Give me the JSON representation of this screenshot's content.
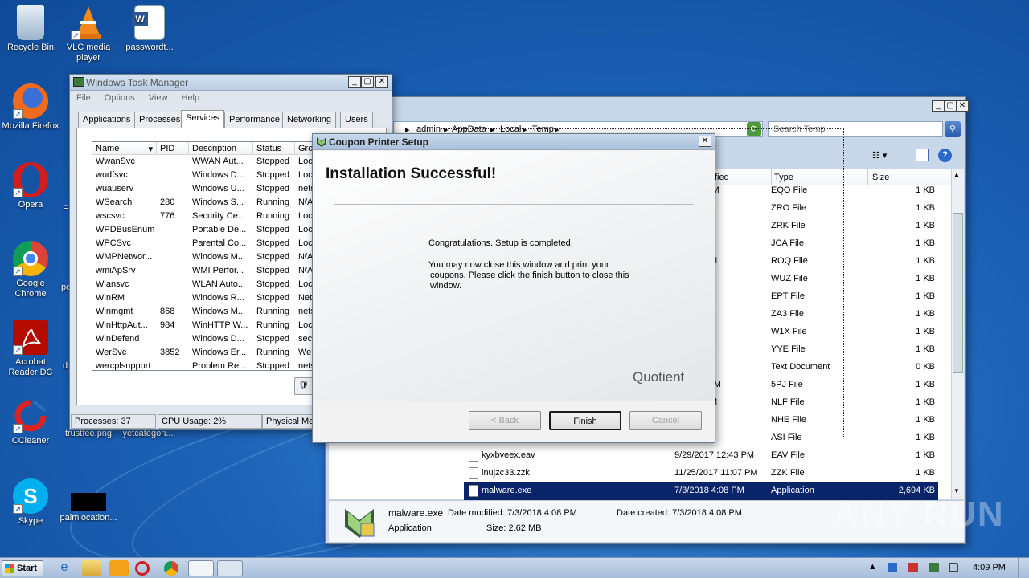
{
  "desktop": {
    "icons": [
      {
        "label": "Recycle Bin"
      },
      {
        "label": "VLC media player"
      },
      {
        "label": "passwordt..."
      },
      {
        "label": "Mozilla Firefox"
      },
      {
        "label": "Opera"
      },
      {
        "label": "Google Chrome"
      },
      {
        "label": "Acrobat Reader DC"
      },
      {
        "label": "CCleaner"
      },
      {
        "label": "Skype"
      },
      {
        "label": "trustfee.png"
      },
      {
        "label": "yetcategori..."
      },
      {
        "label": "palmlocation..."
      }
    ],
    "partial_labels": {
      "opera_side": "F",
      "chrome_side": "po",
      "acrobat_side": "d"
    }
  },
  "task_manager": {
    "title": "Windows Task Manager",
    "menu": [
      "File",
      "Options",
      "View",
      "Help"
    ],
    "tabs": [
      "Applications",
      "Processes",
      "Services",
      "Performance",
      "Networking",
      "Users"
    ],
    "active_tab": "Services",
    "columns": [
      "Name",
      "PID",
      "Description",
      "Status",
      "Gro"
    ],
    "rows": [
      {
        "name": "WwanSvc",
        "pid": "",
        "desc": "WWAN Aut...",
        "status": "Stopped",
        "group": "Loca"
      },
      {
        "name": "wudfsvc",
        "pid": "",
        "desc": "Windows D...",
        "status": "Stopped",
        "group": "Loca"
      },
      {
        "name": "wuauserv",
        "pid": "",
        "desc": "Windows U...",
        "status": "Stopped",
        "group": "nets"
      },
      {
        "name": "WSearch",
        "pid": "280",
        "desc": "Windows S...",
        "status": "Running",
        "group": "N/A"
      },
      {
        "name": "wscsvc",
        "pid": "776",
        "desc": "Security Ce...",
        "status": "Running",
        "group": "Loca"
      },
      {
        "name": "WPDBusEnum",
        "pid": "",
        "desc": "Portable De...",
        "status": "Stopped",
        "group": "Loca"
      },
      {
        "name": "WPCSvc",
        "pid": "",
        "desc": "Parental Co...",
        "status": "Stopped",
        "group": "Loca"
      },
      {
        "name": "WMPNetwor...",
        "pid": "",
        "desc": "Windows M...",
        "status": "Stopped",
        "group": "N/A"
      },
      {
        "name": "wmiApSrv",
        "pid": "",
        "desc": "WMI Perfor...",
        "status": "Stopped",
        "group": "N/A"
      },
      {
        "name": "Wlansvc",
        "pid": "",
        "desc": "WLAN Auto...",
        "status": "Stopped",
        "group": "Loca"
      },
      {
        "name": "WinRM",
        "pid": "",
        "desc": "Windows R...",
        "status": "Stopped",
        "group": "Net"
      },
      {
        "name": "Winmgmt",
        "pid": "868",
        "desc": "Windows M...",
        "status": "Running",
        "group": "nets"
      },
      {
        "name": "WinHttpAut...",
        "pid": "984",
        "desc": "WinHTTP W...",
        "status": "Running",
        "group": "Loca"
      },
      {
        "name": "WinDefend",
        "pid": "",
        "desc": "Windows D...",
        "status": "Stopped",
        "group": "secs"
      },
      {
        "name": "WerSvc",
        "pid": "3852",
        "desc": "Windows Er...",
        "status": "Running",
        "group": "Wer"
      },
      {
        "name": "wercplsupport",
        "pid": "",
        "desc": "Problem Re...",
        "status": "Stopped",
        "group": "nets"
      }
    ],
    "status_bar": {
      "processes": "Processes: 37",
      "cpu": "CPU Usage: 2%",
      "memory": "Physical Mem"
    }
  },
  "explorer": {
    "breadcrumb": [
      "admin",
      "AppData",
      "Local",
      "Temp"
    ],
    "search_placeholder": "Search Temp",
    "columns": {
      "modified": "fied",
      "type": "Type",
      "size": "Size"
    },
    "rows": [
      {
        "name": "",
        "date": "3 10:21 AM",
        "type": "EQO File",
        "size": "1 KB"
      },
      {
        "name": "",
        "date": "3 3:45 PM",
        "type": "ZRO File",
        "size": "1 KB"
      },
      {
        "name": "",
        "date": "3 1:20 AM",
        "type": "ZRK File",
        "size": "1 KB"
      },
      {
        "name": "",
        "date": "5:50 AM",
        "type": "JCA File",
        "size": "1 KB"
      },
      {
        "name": "",
        "date": ".7 4:19 PM",
        "type": "ROQ File",
        "size": "1 KB"
      },
      {
        "name": "",
        "date": "8:59 PM",
        "type": "WUZ File",
        "size": "1 KB"
      },
      {
        "name": "",
        "date": "7 3:42 AM",
        "type": "EPT File",
        "size": "1 KB"
      },
      {
        "name": "",
        "date": "3 5:01 AM",
        "type": "ZA3 File",
        "size": "1 KB"
      },
      {
        "name": "",
        "date": "1:25 AM",
        "type": "W1X File",
        "size": "1 KB"
      },
      {
        "name": "",
        "date": "3 8:08 AM",
        "type": "YYE File",
        "size": "1 KB"
      },
      {
        "name": "",
        "date": "1:56 PM",
        "type": "Text Document",
        "size": "0 KB"
      },
      {
        "name": "",
        "date": ".7 11:48 AM",
        "type": "5PJ File",
        "size": "1 KB"
      },
      {
        "name": "",
        "date": ".7 9:44 PM",
        "type": "NLF File",
        "size": "1 KB"
      },
      {
        "name": "",
        "date": "12:51 AM",
        "type": "NHE File",
        "size": "1 KB"
      },
      {
        "name": "",
        "date": "9:52 AM",
        "type": "ASI File",
        "size": "1 KB"
      },
      {
        "name": "kyxbveex.eav",
        "date": "9/29/2017 12:43 PM",
        "type": "EAV File",
        "size": "1 KB"
      },
      {
        "name": "lnujzc33.zzk",
        "date": "11/25/2017 11:07 PM",
        "type": "ZZK File",
        "size": "1 KB"
      },
      {
        "name": "malware.exe",
        "date": "7/3/2018 4:08 PM",
        "type": "Application",
        "size": "2,694 KB"
      }
    ],
    "details": {
      "name": "malware.exe",
      "modified": "Date modified: 7/3/2018 4:08 PM",
      "created": "Date created: 7/3/2018 4:08 PM",
      "type": "Application",
      "size": "Size: 2.62 MB"
    }
  },
  "setup": {
    "title": "Coupon Printer Setup",
    "heading": "Installation Successful!",
    "line1": "Congratulations. Setup is completed.",
    "line2a": "You may now close this window and print your",
    "line2b": "coupons. Please click the finish button to close this",
    "line2c": "window.",
    "brand": "Quotient",
    "back": "< Back",
    "finish": "Finish",
    "cancel": "Cancel"
  },
  "watermark": "ANY RUN",
  "taskbar": {
    "start": "Start",
    "time": "4:09 PM"
  }
}
